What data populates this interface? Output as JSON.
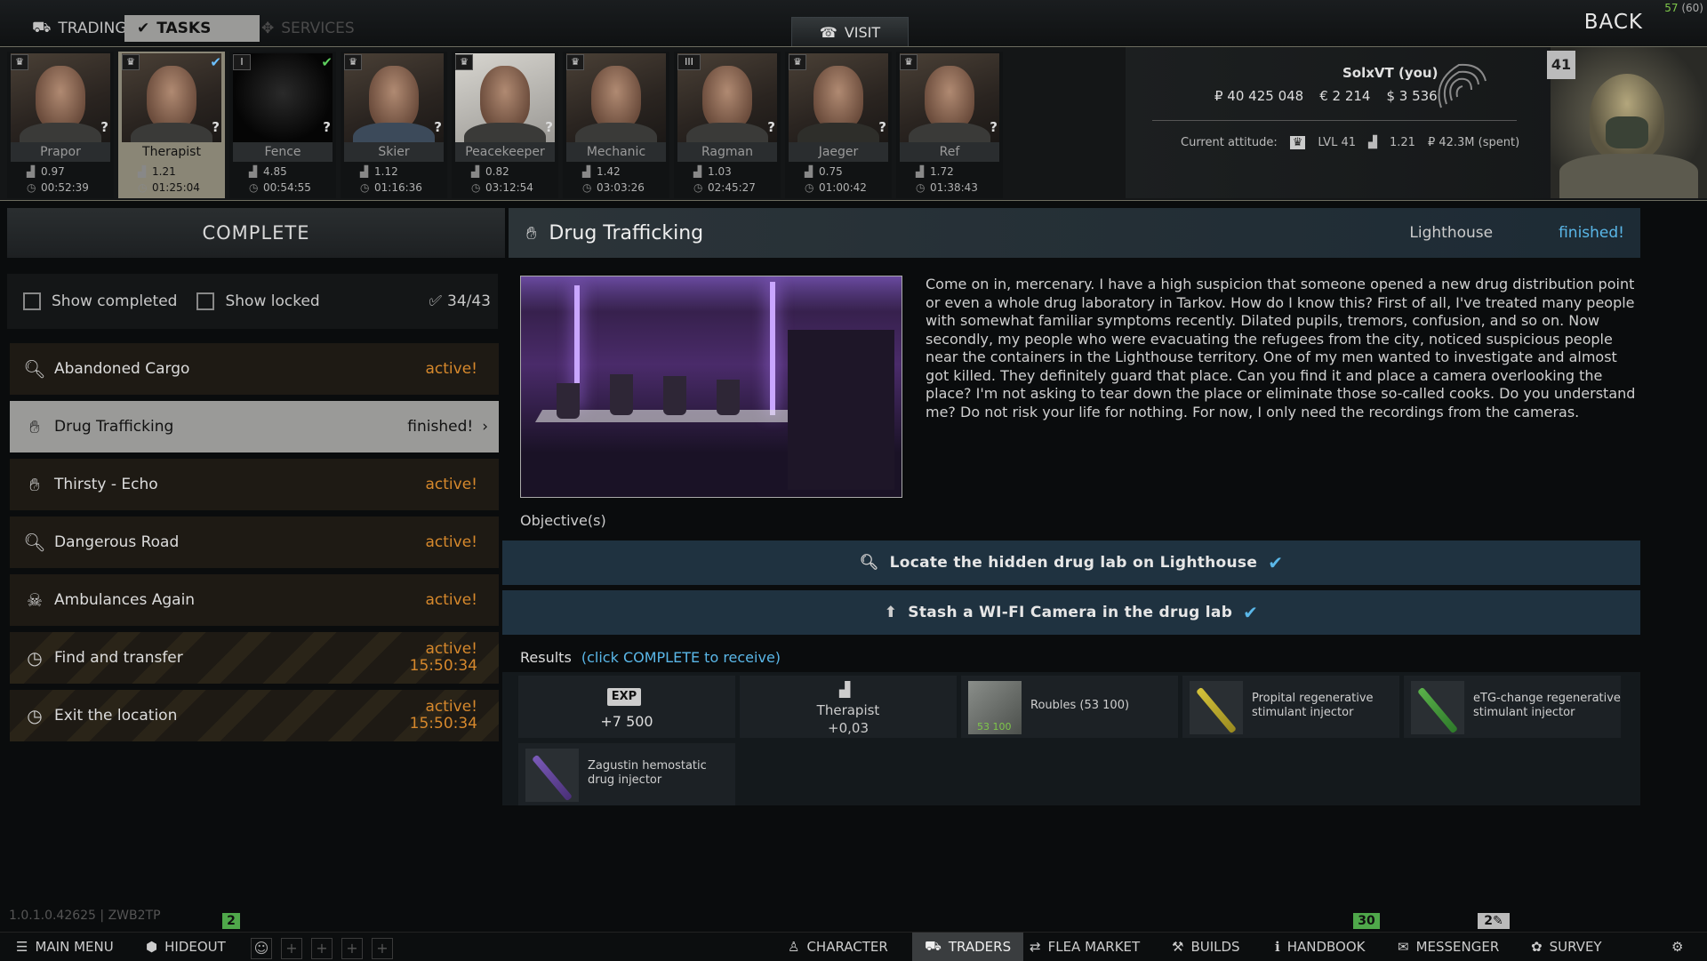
{
  "top_tabs": [
    {
      "label": "TRADING",
      "icon": "trading-icon"
    },
    {
      "label": "TASKS",
      "icon": "tasks-icon"
    },
    {
      "label": "SERVICES",
      "icon": "services-icon"
    }
  ],
  "visit_label": "VISIT",
  "back_label": "BACK",
  "fps": {
    "current": "57",
    "max": "(60)"
  },
  "traders": [
    {
      "name": "Prapor",
      "level": "♛",
      "rep": "0.97",
      "time": "00:52:39",
      "unknown": "?"
    },
    {
      "name": "Therapist",
      "level": "♛",
      "rep": "1.21",
      "time": "01:25:04",
      "unknown": "?"
    },
    {
      "name": "Fence",
      "level": "I",
      "rep": "4.85",
      "time": "00:54:55",
      "unknown": "?"
    },
    {
      "name": "Skier",
      "level": "♛",
      "rep": "1.12",
      "time": "01:16:36",
      "unknown": "?"
    },
    {
      "name": "Peacekeeper",
      "level": "♛",
      "rep": "0.82",
      "time": "03:12:54",
      "unknown": "?"
    },
    {
      "name": "Mechanic",
      "level": "♛",
      "rep": "1.42",
      "time": "03:03:26",
      "unknown": "?"
    },
    {
      "name": "Ragman",
      "level": "III",
      "rep": "1.03",
      "time": "02:45:27",
      "unknown": "?"
    },
    {
      "name": "Jaeger",
      "level": "♛",
      "rep": "0.75",
      "time": "01:00:42",
      "unknown": "?"
    },
    {
      "name": "Ref",
      "level": "♛",
      "rep": "1.72",
      "time": "01:38:43",
      "unknown": "?"
    }
  ],
  "player": {
    "name": "SolxVT (you)",
    "roubles": "₽ 40 425 048",
    "euros": "€ 2 214",
    "dollars": "$ 3 536",
    "attitude_label": "Current attitude:",
    "attitude_level": "LVL 41",
    "attitude_rep": "1.21",
    "attitude_spent": "₽ 42.3M (spent)",
    "level": "41"
  },
  "left": {
    "header": "COMPLETE",
    "show_completed": "Show completed",
    "show_locked": "Show locked",
    "counter": "34/43",
    "quests": [
      {
        "name": "Abandoned Cargo",
        "status": "active!",
        "timer": "",
        "icon": "search-icon"
      },
      {
        "name": "Drug Trafficking",
        "status": "finished!",
        "timer": "",
        "icon": "hand-icon"
      },
      {
        "name": "Thirsty - Echo",
        "status": "active!",
        "timer": "",
        "icon": "hand-icon"
      },
      {
        "name": "Dangerous Road",
        "status": "active!",
        "timer": "",
        "icon": "search-icon"
      },
      {
        "name": "Ambulances Again",
        "status": "active!",
        "timer": "",
        "icon": "skull-crosshair-icon"
      },
      {
        "name": "Find and transfer",
        "status": "active!",
        "timer": "15:50:34",
        "icon": "clock-icon"
      },
      {
        "name": "Exit the location",
        "status": "active!",
        "timer": "15:50:34",
        "icon": "clock-icon"
      }
    ]
  },
  "task": {
    "title": "Drug Trafficking",
    "location": "Lighthouse",
    "status": "finished!",
    "description": "Come on in, mercenary. I have a high suspicion that someone opened a new drug distribution point or even a whole drug laboratory in Tarkov. How do I know this? First of all, I've treated many people with somewhat familiar symptoms recently. Dilated pupils, tremors, confusion, and so on. Now secondly, my people who were evacuating the refugees from the city, noticed suspicious people near the containers in the Lighthouse territory. One of my men wanted to investigate and almost got killed. They definitely guard that place. Can you find it and place a camera overlooking the place? I'm not asking to tear down the place or eliminate those so-called cooks. Do you understand me? Do not risk your life for nothing. For now, I only need the recordings from the cameras.",
    "objectives_label": "Objective(s)",
    "objectives": [
      {
        "text": "Locate the hidden drug lab on Lighthouse",
        "icon": "search-icon"
      },
      {
        "text": "Stash a WI-FI Camera in the drug lab",
        "icon": "stash-icon"
      }
    ],
    "results_label": "Results",
    "results_hint": "(click COMPLETE to receive)",
    "rewards": {
      "exp_badge": "EXP",
      "exp_value": "+7 500",
      "rep_trader": "Therapist",
      "rep_value": "+0,03",
      "items": [
        {
          "name": "Roubles (53 100)",
          "count": "53 100"
        },
        {
          "name": "Propital regenerative stimulant injector"
        },
        {
          "name": "eTG-change regenerative stimulant injector"
        },
        {
          "name": "Zagustin hemostatic drug injector"
        }
      ]
    }
  },
  "bottom": {
    "version": "1.0.1.0.42625 | ZWB2TP",
    "badge_left": "2",
    "badge_traders": "30",
    "badge_messenger": "2",
    "buttons": [
      "MAIN MENU",
      "HIDEOUT",
      "CHARACTER",
      "TRADERS",
      "FLEA MARKET",
      "BUILDS",
      "HANDBOOK",
      "MESSENGER",
      "SURVEY"
    ]
  }
}
